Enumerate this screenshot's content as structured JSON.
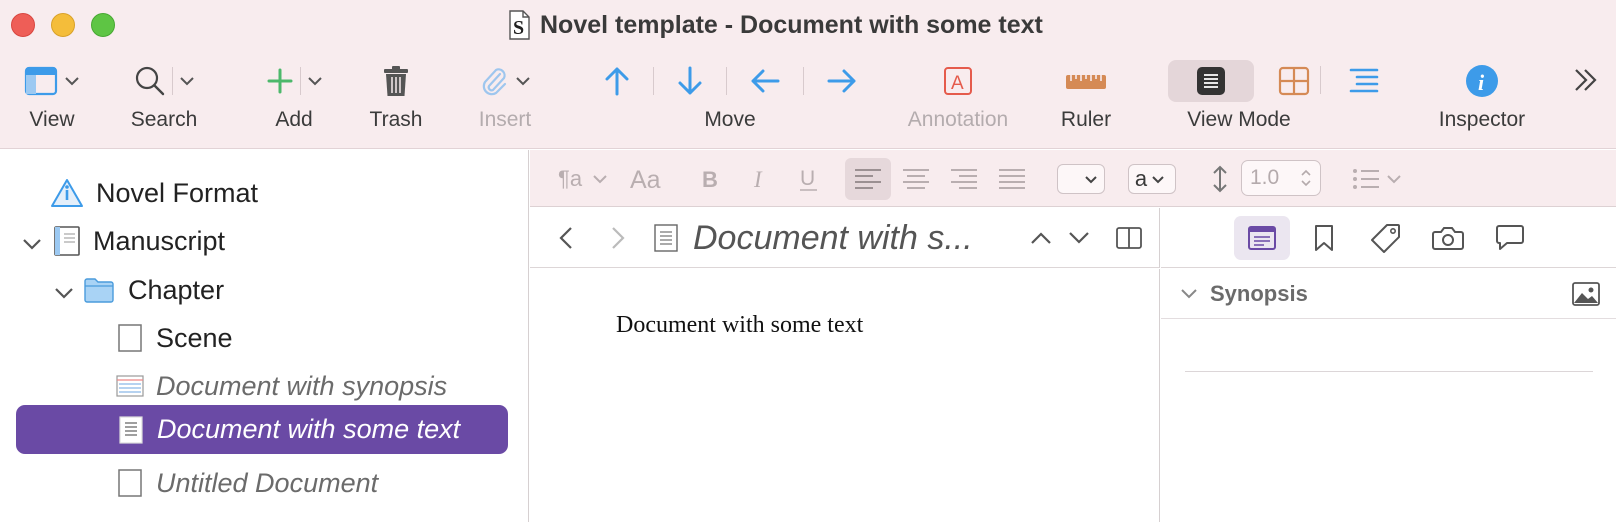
{
  "window": {
    "title": "Novel template - Document with some text"
  },
  "toolbar": {
    "view": "View",
    "search": "Search",
    "add": "Add",
    "trash": "Trash",
    "insert": "Insert",
    "move": "Move",
    "annotation": "Annotation",
    "ruler": "Ruler",
    "view_mode": "View Mode",
    "inspector": "Inspector"
  },
  "binder": {
    "items": [
      {
        "label": "Novel Format",
        "icon": "info-triangle-icon",
        "style": "normal"
      },
      {
        "label": "Manuscript",
        "icon": "manuscript-icon",
        "style": "normal",
        "expanded": true
      },
      {
        "label": "Chapter",
        "icon": "folder-icon",
        "style": "normal",
        "expanded": true
      },
      {
        "label": "Scene",
        "icon": "blank-document-icon",
        "style": "normal"
      },
      {
        "label": "Document with synopsis",
        "icon": "index-card-icon",
        "style": "italic"
      },
      {
        "label": "Document with some text",
        "icon": "text-document-icon",
        "style": "italic",
        "selected": true
      },
      {
        "label": "Untitled Document",
        "icon": "blank-document-icon",
        "style": "italic"
      }
    ]
  },
  "formatbar": {
    "font_select_value": "",
    "style_select_value": "a",
    "line_spacing": "1.0"
  },
  "editor": {
    "header_title": "Document with s...",
    "body_text": "Document with some text"
  },
  "inspector": {
    "section_title": "Synopsis"
  },
  "colors": {
    "chrome_bg": "#f8ecee",
    "selection": "#6a4aa5",
    "accent_blue": "#3d9be9",
    "accent_green": "#4cb86b",
    "accent_orange": "#d58a55"
  }
}
